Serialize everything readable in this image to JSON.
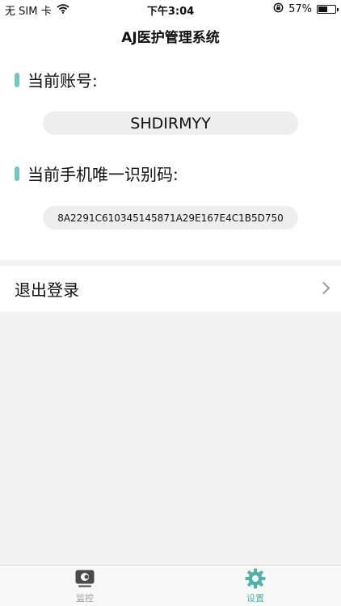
{
  "status_bar": {
    "carrier": "无 SIM 卡",
    "time": "下午3:04",
    "battery_percent": "57%",
    "battery_level": 0.57
  },
  "nav": {
    "title": "AJ医护管理系统"
  },
  "account": {
    "label": "当前账号:",
    "value": "SHDIRMYY"
  },
  "device": {
    "label": "当前手机唯一识别码:",
    "value": "8A2291C610345145871A29E167E4C1B5D750"
  },
  "logout": {
    "label": "退出登录"
  },
  "tabs": [
    {
      "label": "监控",
      "icon": "monitor-icon",
      "active": false
    },
    {
      "label": "设置",
      "icon": "gear-icon",
      "active": true
    }
  ],
  "colors": {
    "accent": "#6ec9bf",
    "tab_active": "#4fb3a8",
    "tab_inactive": "#9a9a9a",
    "background": "#f2f2f2"
  }
}
